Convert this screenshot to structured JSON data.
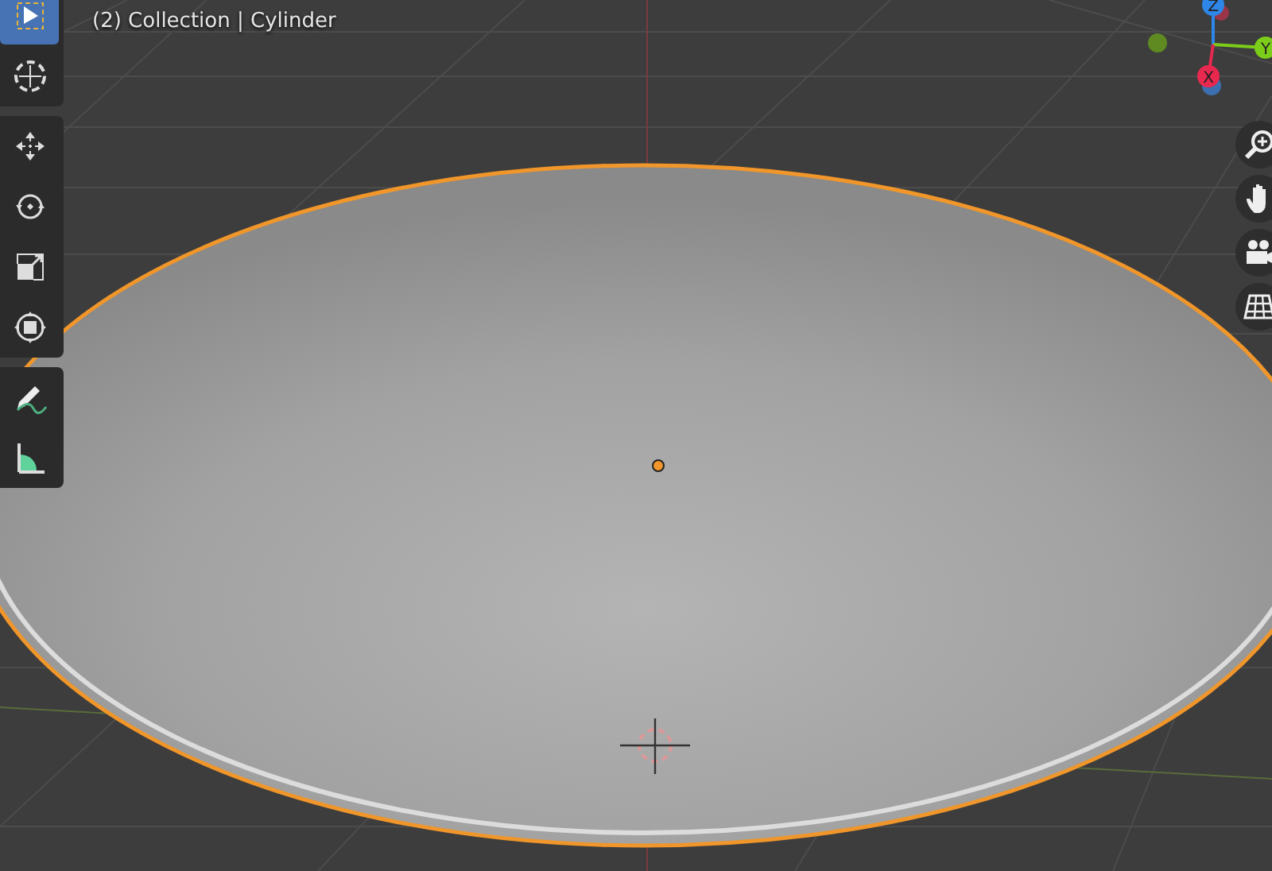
{
  "viewport": {
    "info": "(2) Collection | Cylinder"
  },
  "toolbar": {
    "groups": [
      [
        {
          "kind": "select",
          "selected": true
        },
        {
          "kind": "cursor",
          "selected": false
        }
      ],
      [
        {
          "kind": "move",
          "selected": false
        },
        {
          "kind": "rotate",
          "selected": false
        },
        {
          "kind": "scale",
          "selected": false
        },
        {
          "kind": "transform",
          "selected": false
        }
      ],
      [
        {
          "kind": "annotate",
          "selected": false
        },
        {
          "kind": "measure",
          "selected": false
        }
      ]
    ]
  },
  "gizmo": {
    "axes": [
      {
        "kind": "z",
        "label": "Z"
      },
      {
        "kind": "y",
        "label": "Y"
      },
      {
        "kind": "x",
        "label": "X"
      }
    ]
  },
  "navigation": [
    {
      "kind": "zoom"
    },
    {
      "kind": "pan"
    },
    {
      "kind": "camera"
    },
    {
      "kind": "ortho"
    }
  ]
}
